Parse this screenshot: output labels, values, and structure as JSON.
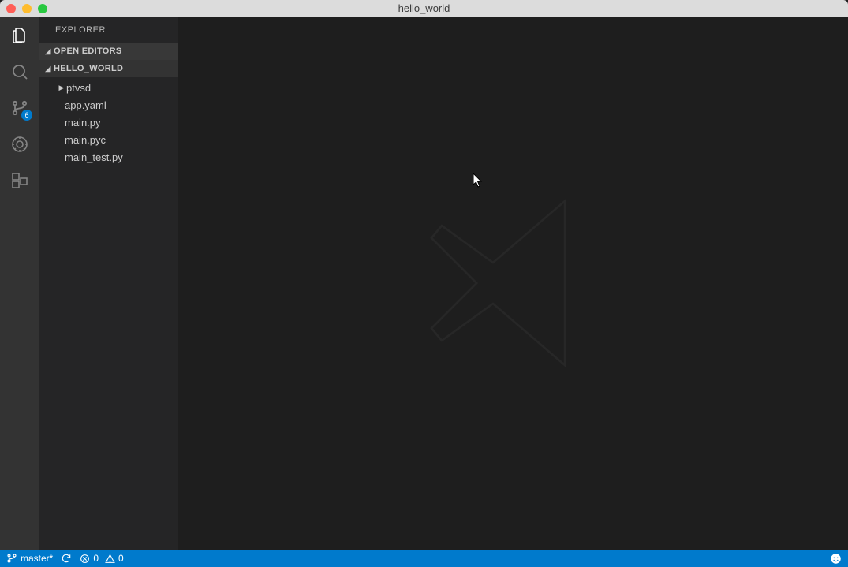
{
  "window": {
    "title": "hello_world"
  },
  "sidebar": {
    "title": "EXPLORER",
    "sections": {
      "open_editors": "OPEN EDITORS",
      "folder_name": "HELLO_WORLD"
    },
    "tree": {
      "folder": "ptvsd",
      "files": [
        "app.yaml",
        "main.py",
        "main.pyc",
        "main_test.py"
      ]
    }
  },
  "activity": {
    "scm_badge": "6"
  },
  "status": {
    "branch": "master*",
    "errors": "0",
    "warnings": "0"
  }
}
